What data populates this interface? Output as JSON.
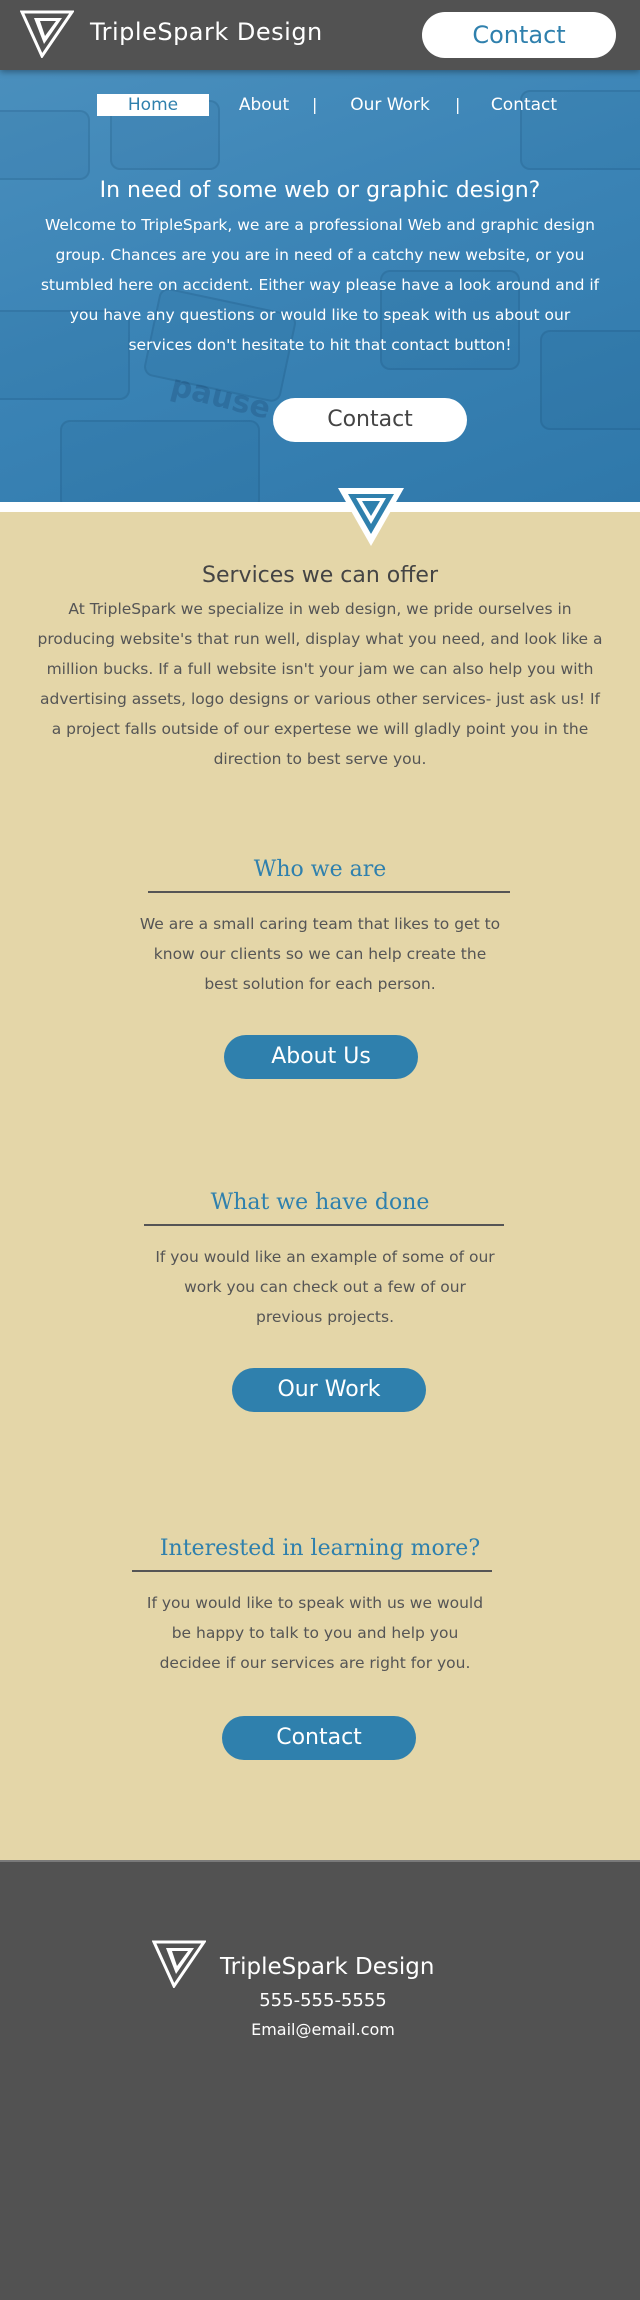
{
  "header": {
    "brand": "TripleSpark Design",
    "contact_label": "Contact"
  },
  "nav": {
    "items": [
      {
        "label": "Home",
        "active": true
      },
      {
        "label": "About"
      },
      {
        "label": "Our Work"
      },
      {
        "label": "Contact"
      }
    ],
    "separator": "|"
  },
  "hero": {
    "title": "In need of some web or graphic design?",
    "text": "Welcome to TripleSpark, we are a professional Web and graphic design group. Chances are you are in need of a catchy new website, or you stumbled here on accident. Either way please have a look around and if you have any questions or would like to speak with us about our services don't hesitate to hit that contact button!",
    "button_label": "Contact",
    "background_text": "pause"
  },
  "services": {
    "title": "Services we can offer",
    "text": "At TripleSpark we specialize in web design, we pride ourselves in producing website's that run well, display what you need, and look like a million bucks. If a full website isn't your jam we can also help you with advertising assets, logo designs or various other services- just ask us! If a project falls outside of our expertese we will gladly point you in the direction to best serve you."
  },
  "sections": [
    {
      "title": "Who we are",
      "text": "We are a small caring team that likes to get to know our clients so we can help create the best solution for each person.",
      "button_label": "About Us"
    },
    {
      "title": "What we have done",
      "text": "If you would like an example of some of our work you can check out a few of our previous projects.",
      "button_label": "Our Work"
    },
    {
      "title": "Interested in learning more?",
      "text": "If you would like to speak with us we would be happy to talk to you and help you decidee if our services are right for you.",
      "button_label": "Contact"
    }
  ],
  "footer": {
    "brand": "TripleSpark Design",
    "phone": "555-555-5555",
    "email": "Email@email.com"
  },
  "colors": {
    "accent": "#2f80ad",
    "header_bg": "#525252",
    "content_bg": "#e4d6a8",
    "hero_bg": "#3b84b6"
  },
  "icons": [
    "triangle-logo-icon"
  ]
}
